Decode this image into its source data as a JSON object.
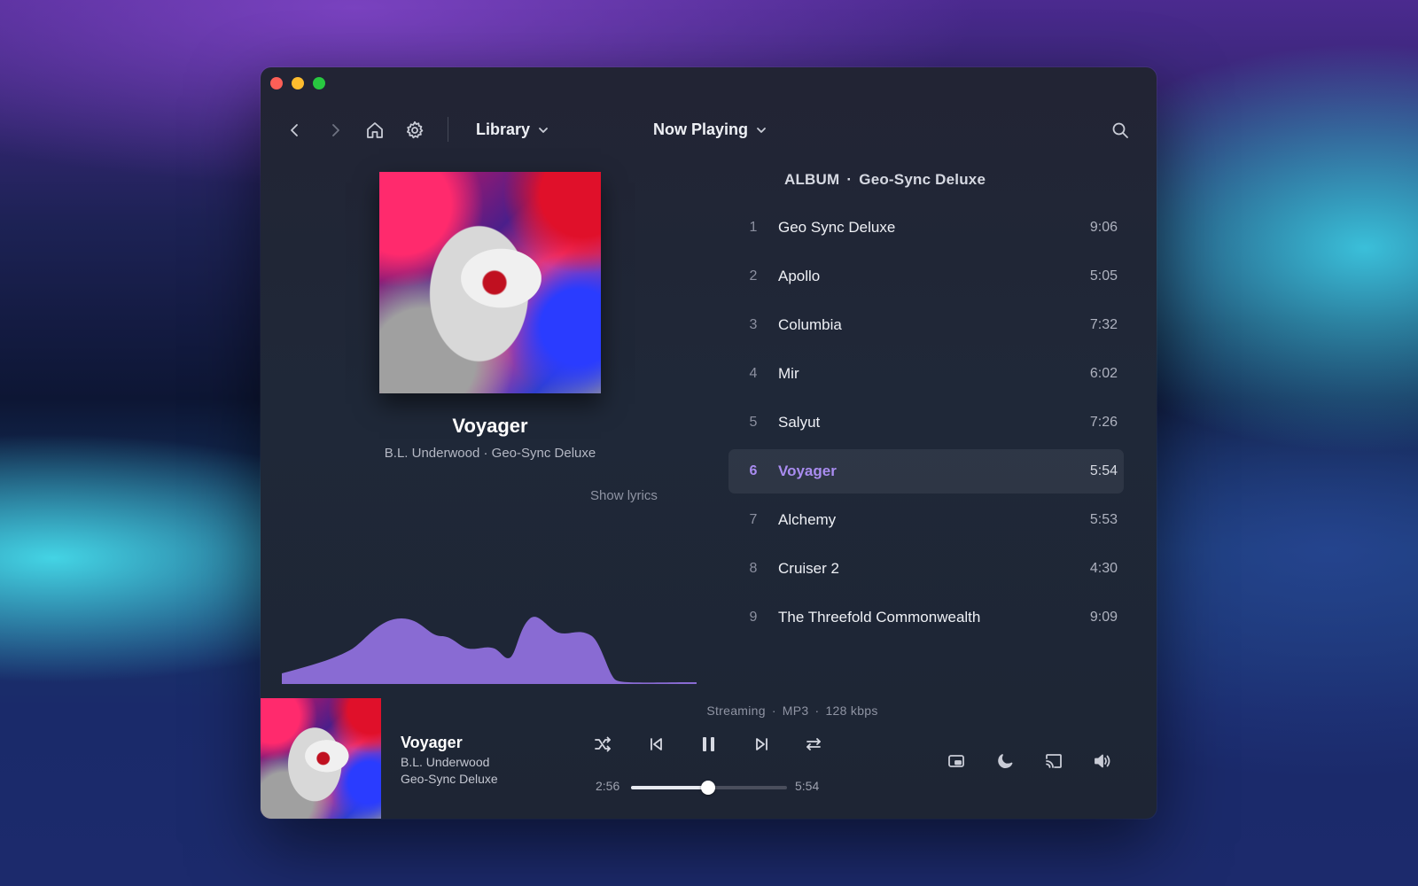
{
  "toolbar": {
    "library_label": "Library",
    "view_label": "Now Playing"
  },
  "now_playing": {
    "title": "Voyager",
    "subtitle": "B.L. Underwood · Geo-Sync Deluxe",
    "show_lyrics_label": "Show lyrics"
  },
  "album": {
    "header_prefix": "ALBUM",
    "header_separator": "·",
    "name": "Geo-Sync Deluxe"
  },
  "tracks": [
    {
      "num": "1",
      "title": "Geo Sync Deluxe",
      "duration": "9:06"
    },
    {
      "num": "2",
      "title": "Apollo",
      "duration": "5:05"
    },
    {
      "num": "3",
      "title": "Columbia",
      "duration": "7:32"
    },
    {
      "num": "4",
      "title": "Mir",
      "duration": "6:02"
    },
    {
      "num": "5",
      "title": "Salyut",
      "duration": "7:26"
    },
    {
      "num": "6",
      "title": "Voyager",
      "duration": "5:54",
      "active": true
    },
    {
      "num": "7",
      "title": "Alchemy",
      "duration": "5:53"
    },
    {
      "num": "8",
      "title": "Cruiser 2",
      "duration": "4:30"
    },
    {
      "num": "9",
      "title": "The Threefold Commonwealth",
      "duration": "9:09"
    }
  ],
  "player": {
    "title": "Voyager",
    "artist": "B.L. Underwood",
    "album": "Geo-Sync Deluxe",
    "source": "Streaming",
    "format": "MP3",
    "bitrate": "128 kbps",
    "separator": "·",
    "elapsed": "2:56",
    "total": "5:54",
    "progress_fraction": 0.497
  },
  "icons": {
    "back": "chevron-left-icon",
    "forward": "chevron-right-icon",
    "home": "home-icon",
    "settings": "gear-icon",
    "search": "search-icon",
    "shuffle": "shuffle-icon",
    "previous": "skip-previous-icon",
    "pause": "pause-icon",
    "next": "skip-next-icon",
    "repeat": "repeat-icon",
    "miniplayer": "picture-in-picture-icon",
    "sleep": "moon-icon",
    "cast": "cast-icon",
    "volume": "volume-icon"
  },
  "colors": {
    "accent": "#a98cf0",
    "waveform": "#8f6fdc"
  }
}
